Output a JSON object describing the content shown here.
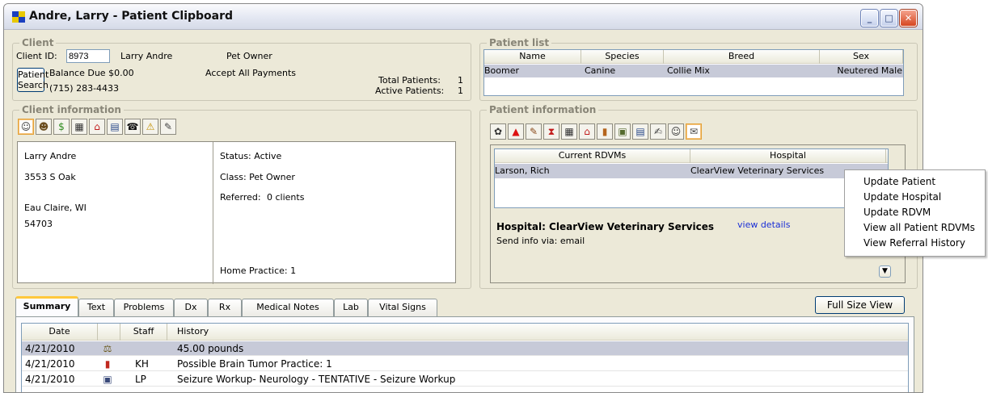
{
  "window": {
    "title": "Andre, Larry - Patient Clipboard",
    "min": "_",
    "max": "□",
    "close": "✕"
  },
  "client": {
    "legend": "Client",
    "id_label": "Client ID:",
    "id_value": "8973",
    "name": "Larry Andre",
    "type": "Pet Owner",
    "search_btn_line1": "Patient",
    "search_btn_line2": "Search",
    "balance": "Balance Due  $0.00",
    "payments": "Accept All Payments",
    "phone": "(715) 283-4433",
    "total_patients_label": "Total Patients:",
    "total_patients": "1",
    "active_patients_label": "Active Patients:",
    "active_patients": "1"
  },
  "patient_list": {
    "legend": "Patient list",
    "columns": [
      "Name",
      "Species",
      "Breed",
      "Sex"
    ],
    "rows": [
      {
        "name": "Boomer",
        "species": "Canine",
        "breed": "Collie Mix",
        "sex": "Neutered Male"
      }
    ]
  },
  "client_info": {
    "legend": "Client information",
    "icons": [
      "person-icon",
      "people-icon",
      "dollar-icon",
      "calculator-icon",
      "house-icon",
      "invoice-icon",
      "phone-icon",
      "warning-icon",
      "notes-icon"
    ],
    "icon_glyphs": [
      "☺",
      "☻",
      "$",
      "▦",
      "⌂",
      "▤",
      "☎",
      "⚠",
      "✎"
    ],
    "name": "Larry Andre",
    "address1": "3553 S Oak",
    "city_state": "Eau Claire, WI",
    "zip": "54703",
    "status": "Status: Active",
    "class": "Class:  Pet Owner",
    "referred_label": "Referred:",
    "referred_value": "0 clients",
    "home_practice": "Home Practice: 1"
  },
  "patient_info": {
    "legend": "Patient information",
    "icons": [
      "paw-icon",
      "alert-icon",
      "syringe-icon",
      "hourglass-icon",
      "calculator-icon",
      "house-icon",
      "door-icon",
      "folder-icon",
      "invoice-icon",
      "notes-icon",
      "person-icon",
      "referral-icon"
    ],
    "icon_glyphs": [
      "✿",
      "▲",
      "✎",
      "⧗",
      "▦",
      "⌂",
      "▮",
      "▣",
      "▤",
      "✍",
      "☺",
      "✉"
    ],
    "rdvm_columns": [
      "Current RDVMs",
      "Hospital"
    ],
    "rdvm_rows": [
      {
        "rdvm": "Larson, Rich",
        "hospital": "ClearView Veterinary Services"
      }
    ],
    "hospital_title": "Hospital: ClearView Veterinary Services",
    "view_details": "view details",
    "send_info": "Send info via: email"
  },
  "context_menu": [
    "Update Patient",
    "Update Hospital",
    "Update RDVM",
    "View all Patient RDVMs",
    "View Referral History"
  ],
  "tabs": [
    "Summary",
    "Text",
    "Problems",
    "Dx",
    "Rx",
    "Medical Notes",
    "Lab",
    "Vital Signs"
  ],
  "full_size_view": "Full Size View",
  "history": {
    "columns": [
      "Date",
      "",
      "Staff",
      "History"
    ],
    "rows": [
      {
        "date": "4/21/2010",
        "icon": "scale-icon",
        "glyph": "⚖",
        "staff": "",
        "history": "45.00 pounds"
      },
      {
        "date": "4/21/2010",
        "icon": "problem-icon",
        "glyph": "▮",
        "staff": "KH",
        "history": "Possible Brain Tumor    Practice: 1"
      },
      {
        "date": "4/21/2010",
        "icon": "appointment-icon",
        "glyph": "▣",
        "staff": "LP",
        "history": "Seizure Workup- Neurology - TENTATIVE - Seizure Workup"
      }
    ]
  }
}
